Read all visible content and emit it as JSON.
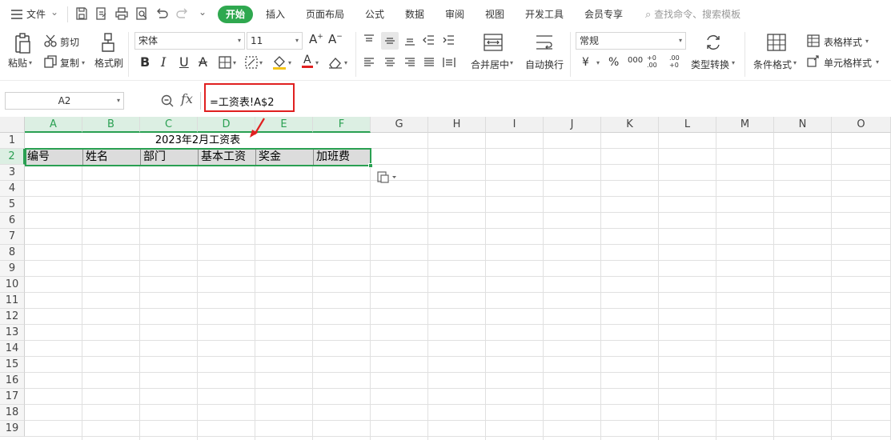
{
  "menubar": {
    "file_label": "文件",
    "tabs": [
      "开始",
      "插入",
      "页面布局",
      "公式",
      "数据",
      "审阅",
      "视图",
      "开发工具",
      "会员专享"
    ],
    "active_tab": "开始",
    "search_placeholder": "查找命令、搜索模板"
  },
  "ribbon": {
    "paste": "粘贴",
    "cut": "剪切",
    "copy": "复制",
    "format_painter": "格式刷",
    "font_name": "宋体",
    "font_size": "11",
    "merge_center": "合并居中",
    "wrap_text": "自动换行",
    "number_format": "常规",
    "currency": "¥",
    "percent": "%",
    "thousands": "000",
    "inc_decimal": "+0 .00",
    "dec_decimal": ".00 +0",
    "type_convert": "类型转换",
    "conditional_format": "条件格式",
    "table_style": "表格样式",
    "cell_style": "单元格样式",
    "accent_color": "#2fa84f",
    "font_color_bar": "#e02020",
    "fill_color_bar": "#f5c518"
  },
  "formula_bar": {
    "cell_ref": "A2",
    "fx": "fx",
    "formula": "=工资表!A$2"
  },
  "sheet": {
    "columns": [
      "A",
      "B",
      "C",
      "D",
      "E",
      "F",
      "G",
      "H",
      "I",
      "J",
      "K",
      "L",
      "M",
      "N",
      "O"
    ],
    "rows": [
      "1",
      "2",
      "3",
      "4",
      "5",
      "6",
      "7",
      "8",
      "9",
      "10",
      "11",
      "12",
      "13",
      "14",
      "15",
      "16",
      "17",
      "18",
      "19"
    ],
    "title": "2023年2月工资表",
    "headers": [
      "编号",
      "姓名",
      "部门",
      "基本工资",
      "奖金",
      "加班费"
    ],
    "selection_color": "#2aa052",
    "highlight_color": "#e02020"
  }
}
